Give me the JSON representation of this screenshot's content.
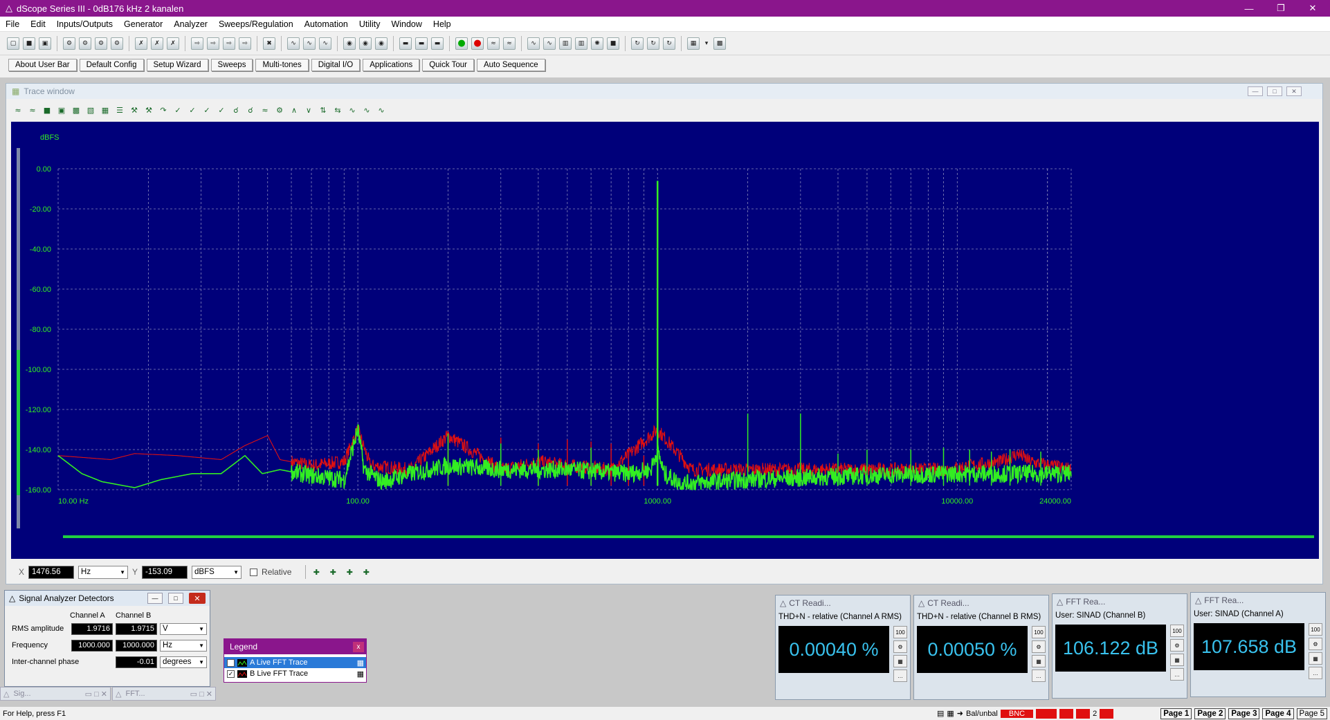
{
  "window": {
    "title": "dScope Series III - 0dB176 kHz 2 kanalen"
  },
  "menu": [
    "File",
    "Edit",
    "Inputs/Outputs",
    "Generator",
    "Analyzer",
    "Sweeps/Regulation",
    "Automation",
    "Utility",
    "Window",
    "Help"
  ],
  "userbar": [
    "About User Bar",
    "Default Config",
    "Setup Wizard",
    "Sweeps",
    "Multi-tones",
    "Digital I/O",
    "Applications",
    "Quick Tour",
    "Auto Sequence"
  ],
  "trace_window": {
    "title": "Trace window"
  },
  "chart_data": {
    "type": "line",
    "ylabel": "dBFS",
    "xscale": "log",
    "xlim": [
      10,
      24000
    ],
    "ylim": [
      -160,
      0
    ],
    "yticks": [
      "0.00",
      "-20.00",
      "-40.00",
      "-60.00",
      "-80.00",
      "-100.00",
      "-120.00",
      "-140.00",
      "-160.00"
    ],
    "xticks": [
      {
        "v": 10,
        "label": "10.00 Hz"
      },
      {
        "v": 100,
        "label": "100.00"
      },
      {
        "v": 1000,
        "label": "1000.00"
      },
      {
        "v": 10000,
        "label": "10000.00"
      },
      {
        "v": 24000,
        "label": "24000.00"
      }
    ],
    "grid": true,
    "background": "#00007a",
    "series": [
      {
        "name": "B Live FFT Trace",
        "color": "#e01010",
        "points": [
          [
            10,
            -143
          ],
          [
            15,
            -145
          ],
          [
            18,
            -142
          ],
          [
            25,
            -143
          ],
          [
            35,
            -145
          ],
          [
            42,
            -138
          ],
          [
            50,
            -133
          ],
          [
            55,
            -145
          ],
          [
            70,
            -148
          ],
          [
            90,
            -146
          ],
          [
            100,
            -130
          ],
          [
            110,
            -148
          ],
          [
            150,
            -150
          ],
          [
            200,
            -133
          ],
          [
            300,
            -150
          ],
          [
            400,
            -146
          ],
          [
            500,
            -148
          ],
          [
            700,
            -150
          ],
          [
            1000,
            -130
          ],
          [
            1300,
            -150
          ],
          [
            2000,
            -150
          ],
          [
            5000,
            -150
          ],
          [
            9000,
            -150
          ],
          [
            14000,
            -146
          ],
          [
            16000,
            -142
          ],
          [
            17500,
            -146
          ],
          [
            24000,
            -150
          ]
        ],
        "peaks": [
          [
            200,
            -131
          ],
          [
            300,
            -134
          ],
          [
            400,
            -137
          ],
          [
            500,
            -135
          ],
          [
            600,
            -136
          ],
          [
            700,
            -137
          ],
          [
            800,
            -140
          ],
          [
            900,
            -143
          ],
          [
            1000,
            -7
          ]
        ]
      },
      {
        "name": "A Live FFT Trace",
        "color": "#33ee22",
        "points": [
          [
            10,
            -143
          ],
          [
            12,
            -152
          ],
          [
            14,
            -156
          ],
          [
            18,
            -159
          ],
          [
            22,
            -155
          ],
          [
            28,
            -152
          ],
          [
            35,
            -152
          ],
          [
            42,
            -143
          ],
          [
            48,
            -152
          ],
          [
            55,
            -150
          ],
          [
            70,
            -153
          ],
          [
            90,
            -155
          ],
          [
            100,
            -130
          ],
          [
            105,
            -150
          ],
          [
            120,
            -156
          ],
          [
            150,
            -152
          ],
          [
            200,
            -148
          ],
          [
            300,
            -150
          ],
          [
            500,
            -150
          ],
          [
            800,
            -152
          ],
          [
            950,
            -150
          ],
          [
            1000,
            -140
          ],
          [
            1050,
            -152
          ],
          [
            1200,
            -157
          ],
          [
            2000,
            -155
          ],
          [
            5000,
            -153
          ],
          [
            10000,
            -152
          ],
          [
            24000,
            -152
          ]
        ],
        "peaks": [
          [
            200,
            -132
          ],
          [
            300,
            -137
          ],
          [
            400,
            -140
          ],
          [
            600,
            -139
          ],
          [
            1000,
            -6
          ],
          [
            2000,
            -122
          ],
          [
            3000,
            -122
          ],
          [
            4000,
            -142
          ],
          [
            5000,
            -140
          ],
          [
            7000,
            -140
          ],
          [
            9000,
            -139
          ],
          [
            11000,
            -140
          ],
          [
            13000,
            -141
          ],
          [
            15000,
            -140
          ],
          [
            19000,
            -141
          ]
        ]
      }
    ]
  },
  "cursor": {
    "x_label": "X",
    "x_value": "1476.56",
    "x_unit": "Hz",
    "y_label": "Y",
    "y_value": "-153.09",
    "y_unit": "dBFS",
    "relative_label": "Relative"
  },
  "detectors": {
    "title": "Signal Analyzer Detectors",
    "col_a": "Channel A",
    "col_b": "Channel B",
    "rows": [
      {
        "label": "RMS amplitude",
        "a": "1.9716",
        "b": "1.9715",
        "unit": "V"
      },
      {
        "label": "Frequency",
        "a": "1000.000",
        "b": "1000.000",
        "unit": "Hz"
      },
      {
        "label": "Inter-channel phase",
        "a": "",
        "b": "-0.01",
        "unit": "degrees"
      }
    ]
  },
  "legend": {
    "title": "Legend",
    "items": [
      {
        "label": "A  Live FFT Trace",
        "color": "#33ee22"
      },
      {
        "label": "B  Live FFT Trace",
        "color": "#e01010"
      }
    ]
  },
  "readings": [
    {
      "title": "CT Readi...",
      "label": "THD+N - relative (Channel A RMS)",
      "value": "0.00040 %"
    },
    {
      "title": "CT Readi...",
      "label": "THD+N - relative (Channel B RMS)",
      "value": "0.00050 %"
    },
    {
      "title": "FFT Rea...",
      "label": "User: SINAD (Channel B)",
      "value": "106.122 dB"
    },
    {
      "title": "FFT Rea...",
      "label": "User: SINAD (Channel A)",
      "value": "107.658 dB"
    }
  ],
  "minimized": [
    {
      "label": "Sig..."
    },
    {
      "label": "FFT..."
    }
  ],
  "status": {
    "help": "For Help, press F1",
    "bal": "Bal/unbal",
    "bnc": "BNC",
    "num": "2",
    "pages": [
      "Page 1",
      "Page 2",
      "Page 3",
      "Page 4",
      "Page 5"
    ]
  }
}
